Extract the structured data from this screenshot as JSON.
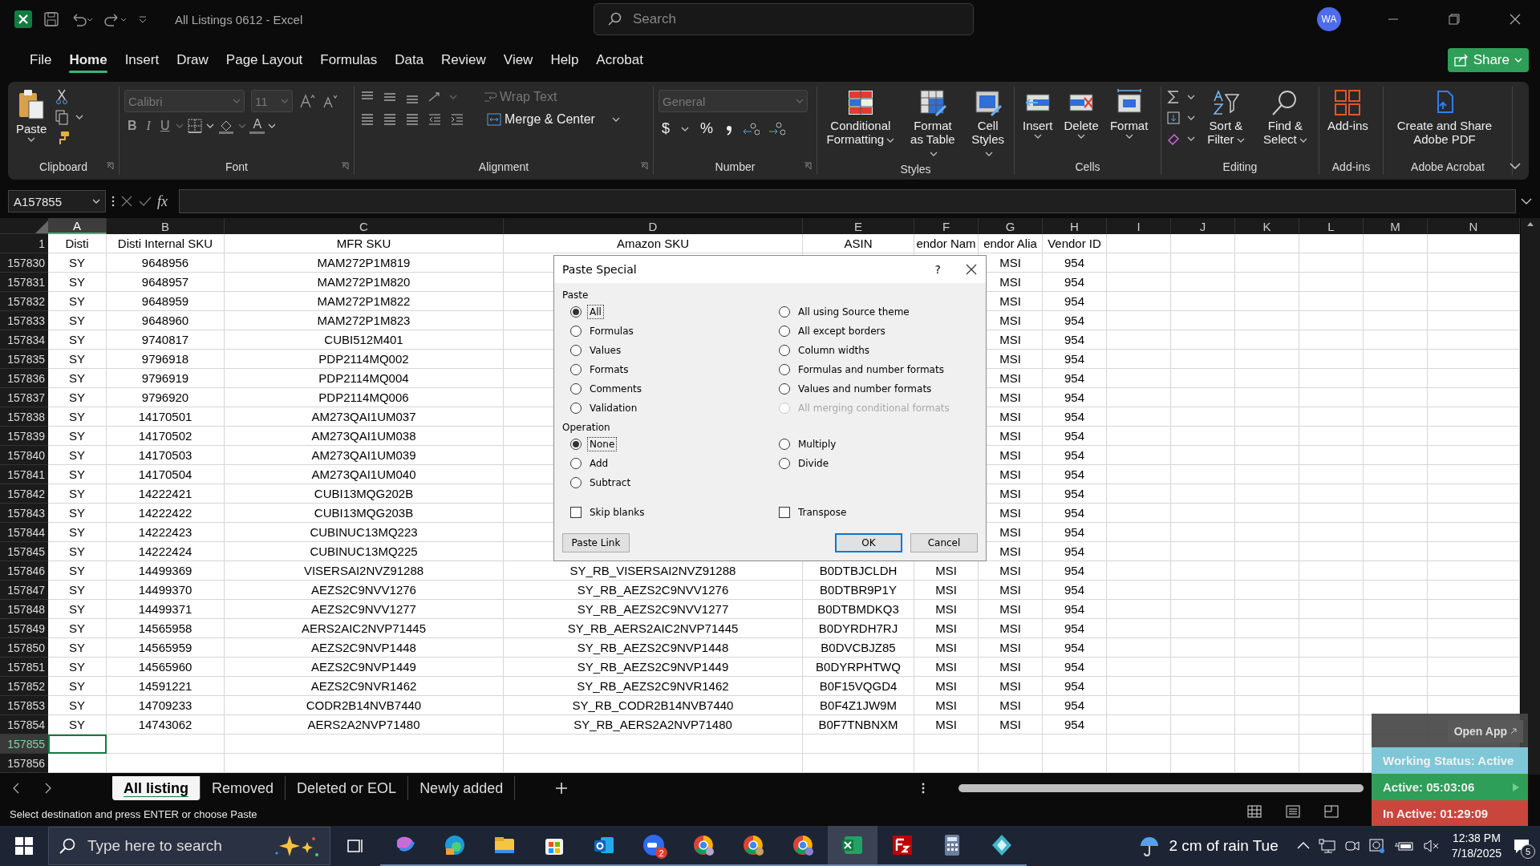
{
  "title_bar": {
    "title": "All Listings 0612  -  Excel",
    "search_placeholder": "Search",
    "avatar": "WA"
  },
  "menu_tabs": [
    {
      "label": "File",
      "selected": false
    },
    {
      "label": "Home",
      "selected": true
    },
    {
      "label": "Insert",
      "selected": false
    },
    {
      "label": "Draw",
      "selected": false
    },
    {
      "label": "Page Layout",
      "selected": false
    },
    {
      "label": "Formulas",
      "selected": false
    },
    {
      "label": "Data",
      "selected": false
    },
    {
      "label": "Review",
      "selected": false
    },
    {
      "label": "View",
      "selected": false
    },
    {
      "label": "Help",
      "selected": false
    },
    {
      "label": "Acrobat",
      "selected": false
    }
  ],
  "share_button": "Share",
  "ribbon": {
    "clipboard": {
      "label": "Clipboard",
      "paste": "Paste"
    },
    "font": {
      "label": "Font",
      "family": "Calibri",
      "size": "11",
      "bold": "B",
      "italic": "I",
      "underline": "U",
      "font_color": "A"
    },
    "alignment": {
      "label": "Alignment",
      "wrap": "Wrap Text",
      "merge": "Merge & Center"
    },
    "number": {
      "label": "Number",
      "format": "General",
      "currency": "$",
      "percent": "%"
    },
    "styles": {
      "label": "Styles",
      "buttons": [
        "Conditional Formatting",
        "Format as Table",
        "Cell Styles"
      ]
    },
    "cells": {
      "label": "Cells",
      "buttons": [
        "Insert",
        "Delete",
        "Format"
      ]
    },
    "editing": {
      "label": "Editing",
      "buttons": [
        "Sort & Filter",
        "Find & Select"
      ]
    },
    "addins": {
      "label": "Add-ins",
      "buttons": [
        "Add-ins"
      ]
    },
    "acrobat": {
      "label": "Adobe Acrobat",
      "buttons": [
        "Create and Share Adobe PDF"
      ]
    }
  },
  "formula_bar": {
    "name_box": "A157855",
    "fx": "fx"
  },
  "columns": [
    {
      "letter": "A",
      "selected": true
    },
    {
      "letter": "B",
      "selected": false
    },
    {
      "letter": "C",
      "selected": false
    },
    {
      "letter": "D",
      "selected": false
    },
    {
      "letter": "E",
      "selected": false
    },
    {
      "letter": "F",
      "selected": false
    },
    {
      "letter": "G",
      "selected": false
    },
    {
      "letter": "H",
      "selected": false
    },
    {
      "letter": "I",
      "selected": false
    },
    {
      "letter": "J",
      "selected": false
    },
    {
      "letter": "K",
      "selected": false
    },
    {
      "letter": "L",
      "selected": false
    },
    {
      "letter": "M",
      "selected": false
    },
    {
      "letter": "N",
      "selected": false
    }
  ],
  "rows": [
    {
      "number": "1",
      "selected": false,
      "cells": [
        "Disti",
        "Disti Internal SKU",
        "MFR SKU",
        "Amazon SKU",
        "ASIN",
        "endor Nam",
        "endor Alia",
        "Vendor ID"
      ]
    },
    {
      "number": "157830",
      "selected": false,
      "cells": [
        "SY",
        "9648956",
        "MAM272P1M819",
        null,
        null,
        null,
        "MSI",
        "954"
      ]
    },
    {
      "number": "157831",
      "selected": false,
      "cells": [
        "SY",
        "9648957",
        "MAM272P1M820",
        null,
        null,
        null,
        "MSI",
        "954"
      ]
    },
    {
      "number": "157832",
      "selected": false,
      "cells": [
        "SY",
        "9648959",
        "MAM272P1M822",
        null,
        null,
        null,
        "MSI",
        "954"
      ]
    },
    {
      "number": "157833",
      "selected": false,
      "cells": [
        "SY",
        "9648960",
        "MAM272P1M823",
        null,
        null,
        null,
        "MSI",
        "954"
      ]
    },
    {
      "number": "157834",
      "selected": false,
      "cells": [
        "SY",
        "9740817",
        "CUBI512M401",
        null,
        null,
        null,
        "MSI",
        "954"
      ]
    },
    {
      "number": "157835",
      "selected": false,
      "cells": [
        "SY",
        "9796918",
        "PDP2114MQ002",
        null,
        null,
        null,
        "MSI",
        "954"
      ]
    },
    {
      "number": "157836",
      "selected": false,
      "cells": [
        "SY",
        "9796919",
        "PDP2114MQ004",
        null,
        null,
        null,
        "MSI",
        "954"
      ]
    },
    {
      "number": "157837",
      "selected": false,
      "cells": [
        "SY",
        "9796920",
        "PDP2114MQ006",
        null,
        null,
        null,
        "MSI",
        "954"
      ]
    },
    {
      "number": "157838",
      "selected": false,
      "cells": [
        "SY",
        "14170501",
        "AM273QAI1UM037",
        null,
        null,
        null,
        "MSI",
        "954"
      ]
    },
    {
      "number": "157839",
      "selected": false,
      "cells": [
        "SY",
        "14170502",
        "AM273QAI1UM038",
        null,
        null,
        null,
        "MSI",
        "954"
      ]
    },
    {
      "number": "157840",
      "selected": false,
      "cells": [
        "SY",
        "14170503",
        "AM273QAI1UM039",
        null,
        null,
        null,
        "MSI",
        "954"
      ]
    },
    {
      "number": "157841",
      "selected": false,
      "cells": [
        "SY",
        "14170504",
        "AM273QAI1UM040",
        null,
        null,
        null,
        "MSI",
        "954"
      ]
    },
    {
      "number": "157842",
      "selected": false,
      "cells": [
        "SY",
        "14222421",
        "CUBI13MQG202B",
        null,
        null,
        null,
        "MSI",
        "954"
      ]
    },
    {
      "number": "157843",
      "selected": false,
      "cells": [
        "SY",
        "14222422",
        "CUBI13MQG203B",
        null,
        null,
        null,
        "MSI",
        "954"
      ]
    },
    {
      "number": "157844",
      "selected": false,
      "cells": [
        "SY",
        "14222423",
        "CUBINUC13MQ223",
        null,
        null,
        null,
        "MSI",
        "954"
      ]
    },
    {
      "number": "157845",
      "selected": false,
      "cells": [
        "SY",
        "14222424",
        "CUBINUC13MQ225",
        null,
        null,
        null,
        "MSI",
        "954"
      ]
    },
    {
      "number": "157846",
      "selected": false,
      "cells": [
        "SY",
        "14499369",
        "VISERSAI2NVZ91288",
        "SY_RB_VISERSAI2NVZ91288",
        "B0DTBJCLDH",
        "MSI",
        "MSI",
        "954"
      ]
    },
    {
      "number": "157847",
      "selected": false,
      "cells": [
        "SY",
        "14499370",
        "AEZS2C9NVV1276",
        "SY_RB_AEZS2C9NVV1276",
        "B0DTBR9P1Y",
        "MSI",
        "MSI",
        "954"
      ]
    },
    {
      "number": "157848",
      "selected": false,
      "cells": [
        "SY",
        "14499371",
        "AEZS2C9NVV1277",
        "SY_RB_AEZS2C9NVV1277",
        "B0DTBMDKQ3",
        "MSI",
        "MSI",
        "954"
      ]
    },
    {
      "number": "157849",
      "selected": false,
      "cells": [
        "SY",
        "14565958",
        "AERS2AIC2NVP71445",
        "SY_RB_AERS2AIC2NVP71445",
        "B0DYRDH7RJ",
        "MSI",
        "MSI",
        "954"
      ]
    },
    {
      "number": "157850",
      "selected": false,
      "cells": [
        "SY",
        "14565959",
        "AEZS2C9NVP1448",
        "SY_RB_AEZS2C9NVP1448",
        "B0DVCBJZ85",
        "MSI",
        "MSI",
        "954"
      ]
    },
    {
      "number": "157851",
      "selected": false,
      "cells": [
        "SY",
        "14565960",
        "AEZS2C9NVP1449",
        "SY_RB_AEZS2C9NVP1449",
        "B0DYRPHTWQ",
        "MSI",
        "MSI",
        "954"
      ]
    },
    {
      "number": "157852",
      "selected": false,
      "cells": [
        "SY",
        "14591221",
        "AEZS2C9NVR1462",
        "SY_RB_AEZS2C9NVR1462",
        "B0F15VQGD4",
        "MSI",
        "MSI",
        "954"
      ]
    },
    {
      "number": "157853",
      "selected": false,
      "cells": [
        "SY",
        "14709233",
        "CODR2B14NVB7440",
        "SY_RB_CODR2B14NVB7440",
        "B0F4Z1JW9M",
        "MSI",
        "MSI",
        "954"
      ]
    },
    {
      "number": "157854",
      "selected": false,
      "cells": [
        "SY",
        "14743062",
        "AERS2A2NVP71480",
        "SY_RB_AERS2A2NVP71480",
        "B0F7TNBNXM",
        "MSI",
        "MSI",
        "954"
      ]
    },
    {
      "number": "157855",
      "selected": true,
      "cells": []
    },
    {
      "number": "157856",
      "selected": false,
      "cells": []
    }
  ],
  "dialog": {
    "title": "Paste Special",
    "help": "?",
    "paste_label": "Paste",
    "paste_options": [
      {
        "label": "All",
        "selected": true,
        "disabled": false
      },
      {
        "label": "Formulas",
        "selected": false,
        "disabled": false
      },
      {
        "label": "Values",
        "selected": false,
        "disabled": false
      },
      {
        "label": "Formats",
        "selected": false,
        "disabled": false
      },
      {
        "label": "Comments",
        "selected": false,
        "disabled": false
      },
      {
        "label": "Validation",
        "selected": false,
        "disabled": false
      },
      {
        "label": "All using Source theme",
        "selected": false,
        "disabled": false
      },
      {
        "label": "All except borders",
        "selected": false,
        "disabled": false
      },
      {
        "label": "Column widths",
        "selected": false,
        "disabled": false
      },
      {
        "label": "Formulas and number formats",
        "selected": false,
        "disabled": false
      },
      {
        "label": "Values and number formats",
        "selected": false,
        "disabled": false
      },
      {
        "label": "All merging conditional formats",
        "selected": false,
        "disabled": true
      }
    ],
    "operation_label": "Operation",
    "operation_options": [
      {
        "label": "None",
        "selected": true
      },
      {
        "label": "Add",
        "selected": false
      },
      {
        "label": "Subtract",
        "selected": false
      },
      {
        "label": "Multiply",
        "selected": false
      },
      {
        "label": "Divide",
        "selected": false
      }
    ],
    "checkboxes": [
      {
        "label": "Skip blanks",
        "checked": false
      },
      {
        "label": "Transpose",
        "checked": false
      }
    ],
    "buttons": [
      {
        "label": "Paste Link",
        "kind": "normal"
      },
      {
        "label": "OK",
        "kind": "default"
      },
      {
        "label": "Cancel",
        "kind": "normal"
      }
    ]
  },
  "sheet_tabs": [
    {
      "label": "All listing",
      "selected": true
    },
    {
      "label": "Removed",
      "selected": false
    },
    {
      "label": "Deleted or EOL",
      "selected": false
    },
    {
      "label": "Newly added",
      "selected": false
    }
  ],
  "status_bar": {
    "message": "Select destination and press ENTER or choose Paste"
  },
  "tracker": {
    "open_app": "Open App",
    "status": "Working Status: Active",
    "active": "Active: 05:03:06",
    "inactive": "In Active: 01:29:09"
  },
  "taskbar": {
    "search_placeholder": "Type here to search",
    "apps": [
      {
        "selected": false
      },
      {
        "selected": false
      },
      {
        "selected": false
      },
      {
        "selected": false
      },
      {
        "selected": false
      },
      {
        "selected": false,
        "badge": "2"
      },
      {
        "selected": false
      },
      {
        "selected": false
      },
      {
        "selected": false
      },
      {
        "selected": true
      },
      {
        "selected": false
      },
      {
        "selected": false
      },
      {
        "selected": false
      }
    ],
    "weather": "2 cm of rain Tue",
    "time": "12:38 PM",
    "date": "7/18/2025",
    "notifications": "5"
  }
}
